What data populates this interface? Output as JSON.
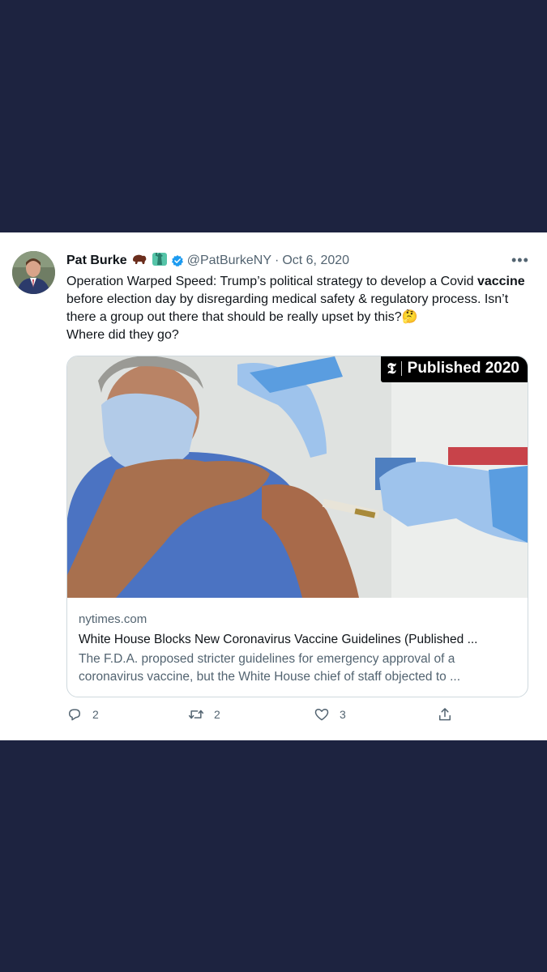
{
  "tweet": {
    "author_name": "Pat Burke",
    "handle": "@PatBurkeNY",
    "separator": "·",
    "date": "Oct 6, 2020",
    "more": "•••",
    "text_part1": "Operation Warped Speed: Trump’s political strategy to develop a Covid ",
    "text_bold": "vaccine",
    "text_part2": " before election day by disregarding medical safety & regulatory process. Isn’t there a group out there that should be really upset by this?",
    "emoji_end": "🤔",
    "text_part3": "Where did they go?"
  },
  "link_card": {
    "badge_text": "Published 2020",
    "domain": "nytimes.com",
    "headline": "White House Blocks New Coronavirus Vaccine Guidelines (Published ...",
    "description": "The F.D.A. proposed stricter guidelines for emergency approval of a coronavirus vaccine, but the White House chief of staff objected to ..."
  },
  "actions": {
    "replies": "2",
    "retweets": "2",
    "likes": "3"
  },
  "icons": [
    "reply-icon",
    "retweet-icon",
    "like-icon",
    "share-icon",
    "verified-icon",
    "more-icon"
  ],
  "colors": {
    "background": "#1d2340",
    "card": "#ffffff",
    "verified": "#1d9bf0",
    "muted": "#536471"
  }
}
